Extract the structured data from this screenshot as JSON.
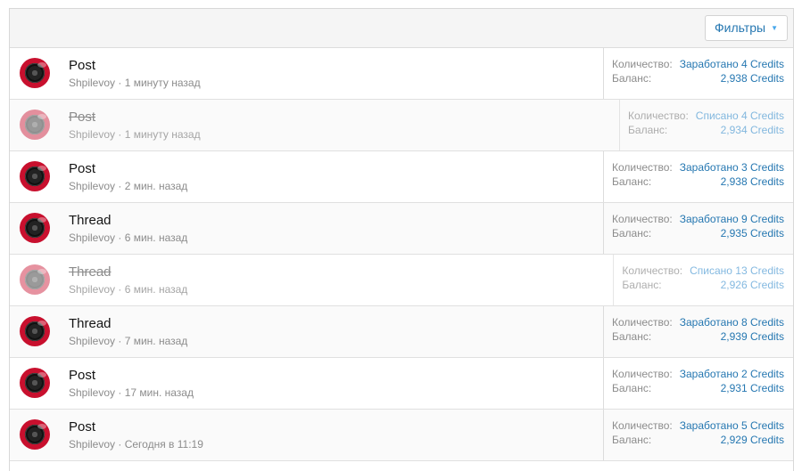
{
  "header": {
    "filter_label": "Фильтры"
  },
  "labels": {
    "amount": "Количество:",
    "balance": "Баланс:"
  },
  "rows": [
    {
      "title": "Post",
      "user": "Shpilevoy",
      "time": "· 1 минуту назад",
      "amount": "Заработано 4 Credits",
      "balance": "2,938 Credits",
      "deleted": false
    },
    {
      "title": "Post",
      "user": "Shpilevoy",
      "time": "· 1 минуту назад",
      "amount": "Списано 4 Credits",
      "balance": "2,934 Credits",
      "deleted": true
    },
    {
      "title": "Post",
      "user": "Shpilevoy",
      "time": "· 2 мин. назад",
      "amount": "Заработано 3 Credits",
      "balance": "2,938 Credits",
      "deleted": false
    },
    {
      "title": "Thread",
      "user": "Shpilevoy",
      "time": "· 6 мин. назад",
      "amount": "Заработано 9 Credits",
      "balance": "2,935 Credits",
      "deleted": false
    },
    {
      "title": "Thread",
      "user": "Shpilevoy",
      "time": "· 6 мин. назад",
      "amount": "Списано 13 Credits",
      "balance": "2,926 Credits",
      "deleted": true
    },
    {
      "title": "Thread",
      "user": "Shpilevoy",
      "time": "· 7 мин. назад",
      "amount": "Заработано 8 Credits",
      "balance": "2,939 Credits",
      "deleted": false
    },
    {
      "title": "Post",
      "user": "Shpilevoy",
      "time": "· 17 мин. назад",
      "amount": "Заработано 2 Credits",
      "balance": "2,931 Credits",
      "deleted": false
    },
    {
      "title": "Post",
      "user": "Shpilevoy",
      "time": "· Сегодня в 11:19",
      "amount": "Заработано 5 Credits",
      "balance": "2,929 Credits",
      "deleted": false
    }
  ],
  "colors": {
    "link": "#2577b1",
    "muted": "#8c8c8c",
    "avatar_red": "#c8102e"
  }
}
